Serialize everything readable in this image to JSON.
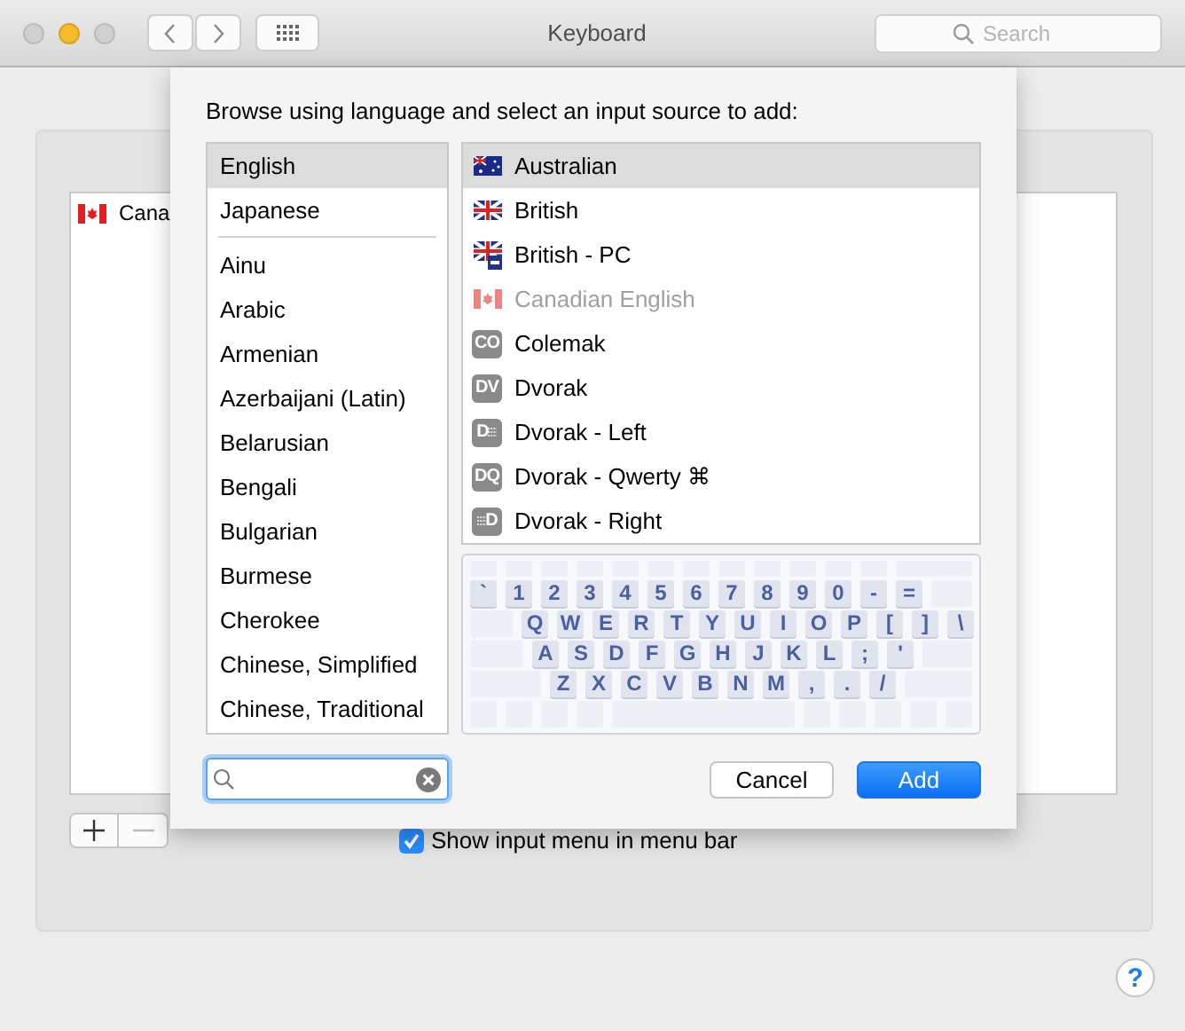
{
  "window": {
    "title": "Keyboard",
    "search": {
      "placeholder": "Search"
    }
  },
  "background": {
    "input_sources": [
      {
        "label": "Cana",
        "kind": "flag_ca"
      }
    ],
    "show_input_menu": {
      "label": "Show input menu in menu bar",
      "checked": true
    }
  },
  "sheet": {
    "prompt": "Browse using language and select an input source to add:",
    "preferred_languages": [
      {
        "label": "English",
        "selected": true
      },
      {
        "label": "Japanese",
        "selected": false
      }
    ],
    "languages": [
      {
        "label": "Ainu",
        "selected": false
      },
      {
        "label": "Arabic",
        "selected": false
      },
      {
        "label": "Armenian",
        "selected": false
      },
      {
        "label": "Azerbaijani (Latin)",
        "selected": false
      },
      {
        "label": "Belarusian",
        "selected": false
      },
      {
        "label": "Bengali",
        "selected": false
      },
      {
        "label": "Bulgarian",
        "selected": false
      },
      {
        "label": "Burmese",
        "selected": false
      },
      {
        "label": "Cherokee",
        "selected": false
      },
      {
        "label": "Chinese, Simplified",
        "selected": false
      },
      {
        "label": "Chinese, Traditional",
        "selected": false
      }
    ],
    "sources": [
      {
        "label": "Australian",
        "kind": "flag_au",
        "selected": true,
        "disabled": false
      },
      {
        "label": "British",
        "kind": "flag_uk",
        "selected": false,
        "disabled": false
      },
      {
        "label": "British - PC",
        "kind": "flag_uk_pc",
        "selected": false,
        "disabled": false
      },
      {
        "label": "Canadian English",
        "kind": "flag_ca",
        "selected": false,
        "disabled": true
      },
      {
        "label": "Colemak",
        "kind": "badge",
        "badge": "CO",
        "selected": false,
        "disabled": false
      },
      {
        "label": "Dvorak",
        "kind": "badge",
        "badge": "DV",
        "selected": false,
        "disabled": false
      },
      {
        "label": "Dvorak - Left",
        "kind": "badge_left",
        "badge": "D",
        "selected": false,
        "disabled": false
      },
      {
        "label": "Dvorak - Qwerty ⌘",
        "kind": "badge",
        "badge": "DQ",
        "selected": false,
        "disabled": false
      },
      {
        "label": "Dvorak - Right",
        "kind": "badge_right",
        "badge": "D",
        "selected": false,
        "disabled": false
      }
    ],
    "keyboard_rows": [
      [
        "`",
        "1",
        "2",
        "3",
        "4",
        "5",
        "6",
        "7",
        "8",
        "9",
        "0",
        "-",
        "="
      ],
      [
        "Q",
        "W",
        "E",
        "R",
        "T",
        "Y",
        "U",
        "I",
        "O",
        "P",
        "[",
        "]",
        "\\"
      ],
      [
        "A",
        "S",
        "D",
        "F",
        "G",
        "H",
        "J",
        "K",
        "L",
        ";",
        "'"
      ],
      [
        "Z",
        "X",
        "C",
        "V",
        "B",
        "N",
        "M",
        ",",
        ".",
        "/"
      ]
    ],
    "buttons": [
      {
        "label": "Cancel",
        "kind": "normal"
      },
      {
        "label": "Add",
        "kind": "default"
      }
    ]
  },
  "help": {
    "label": "?"
  }
}
